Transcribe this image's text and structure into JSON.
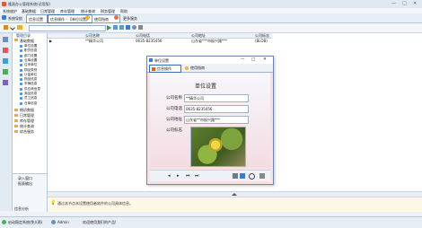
{
  "app": {
    "title": "隆昌办公管理系统(试用版)"
  },
  "window_controls": {
    "minimize": "—",
    "maximize": "□",
    "close": "✕"
  },
  "menu": [
    {
      "label": "系统维护"
    },
    {
      "label": "基础数据"
    },
    {
      "label": "日常管理"
    },
    {
      "label": "库存管理"
    },
    {
      "label": "统计查询"
    },
    {
      "label": "财务管理"
    },
    {
      "label": "帮助"
    }
  ],
  "tabs": [
    {
      "label": "系统导航"
    },
    {
      "label": "信息设置"
    },
    {
      "label": "信息操作 - 【单位设置】"
    },
    {
      "label": "使用指南"
    },
    {
      "label": "更多服务"
    }
  ],
  "tree": {
    "header": "管理目录",
    "root": "基础数据",
    "items": [
      "单位设置",
      "职员信息",
      "部门设置",
      "仓库设置",
      "往来单位",
      "物品类别",
      "计量单位",
      "物品信息",
      "车辆信息",
      "供应商信息",
      "商品信息",
      "员工信息",
      "仓库信息"
    ],
    "groups": [
      "期初数据",
      "日常管理",
      "库存管理",
      "统计查询",
      "综合服务"
    ]
  },
  "sidebar_bottom": {
    "items": [
      "录入窗口",
      "报表输出",
      "信息分析"
    ]
  },
  "table": {
    "columns": [
      "公司名称",
      "公司电话",
      "公司地址",
      "公司标志"
    ],
    "rows": [
      {
        "marker": "▶",
        "name": "**精华公司",
        "phone": "0635-8235456",
        "address": "山东省***市振兴路***",
        "logo": "(BLOB)"
      }
    ]
  },
  "dialog": {
    "title": "单位设置",
    "tabs": [
      "信息操作",
      "使用指南"
    ],
    "heading": "单位设置",
    "fields": [
      {
        "label": "公司名称",
        "value": "**精华公司"
      },
      {
        "label": "公司电话",
        "value": "0635-8235456"
      },
      {
        "label": "公司地址",
        "value": "山东省**市振兴路***"
      }
    ],
    "logo_label": "公司标志",
    "nav": [
      "◂",
      "▸",
      "⏮",
      "⏭"
    ]
  },
  "message": {
    "text": "通过本节点本设置使用者软件的公司具体信息。",
    "icon": "💡"
  },
  "statusbar": {
    "left": "启动稳定系统(免)(两)",
    "user": "Admin",
    "right": "欢迎使用我们的产品!"
  },
  "colors": {
    "accent": "#2f6fb5",
    "tab_active": "#ffffff",
    "dialog_bg": "#f3e3e6",
    "window_bg": "#eef2f7"
  }
}
